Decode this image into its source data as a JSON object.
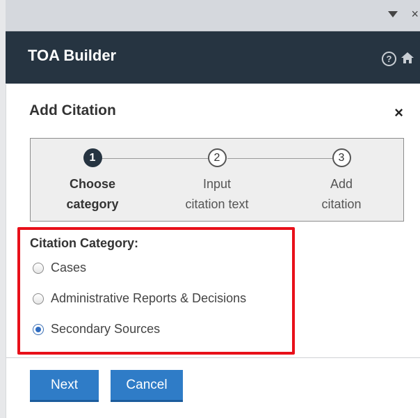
{
  "app": {
    "title": "TOA Builder"
  },
  "pane": {
    "menu_icon": "caret-down-icon",
    "close_glyph": "×"
  },
  "header_icons": {
    "help_glyph": "?",
    "home_icon": "home-icon"
  },
  "dialog": {
    "title": "Add Citation",
    "close_glyph": "×"
  },
  "stepper": {
    "steps": [
      {
        "number": "1",
        "label": "Choose\ncategory",
        "state": "active"
      },
      {
        "number": "2",
        "label": "Input\ncitation text",
        "state": "pending"
      },
      {
        "number": "3",
        "label": "Add\ncitation",
        "state": "pending"
      }
    ]
  },
  "category": {
    "label": "Citation Category:",
    "options": [
      {
        "label": "Cases",
        "checked": false
      },
      {
        "label": "Administrative Reports & Decisions",
        "checked": false
      },
      {
        "label": "Secondary Sources",
        "checked": true
      }
    ]
  },
  "actions": {
    "next_label": "Next",
    "cancel_label": "Cancel"
  },
  "colors": {
    "header_bg": "#263441",
    "accent_button": "#2f7cc7",
    "highlight": "#e8101a"
  }
}
